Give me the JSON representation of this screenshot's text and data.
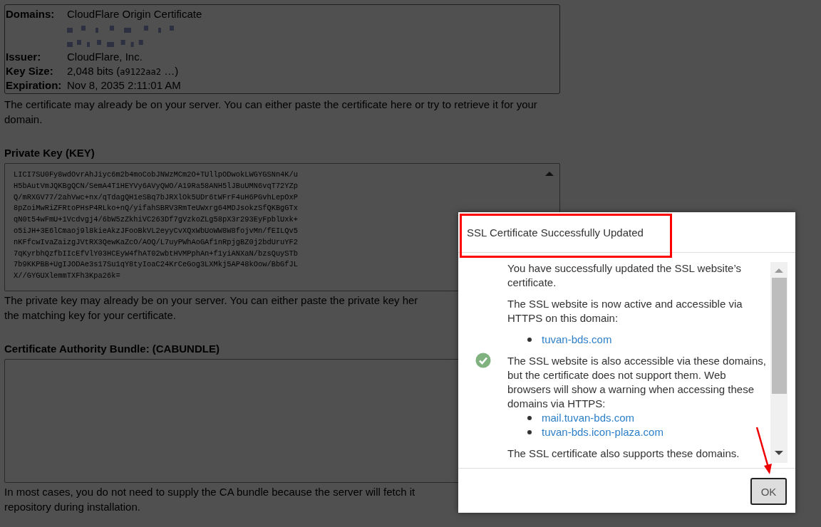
{
  "certificate": {
    "rows": [
      {
        "kind": "text",
        "label": "Domains:",
        "value": "CloudFlare Origin Certificate"
      },
      {
        "kind": "redacted"
      },
      {
        "kind": "redacted"
      },
      {
        "kind": "text",
        "label": "Issuer:",
        "value": "CloudFlare, Inc."
      },
      {
        "kind": "keysize",
        "label": "Key Size:",
        "value": "2,048 bits (",
        "code": "a9122aa2",
        "suffix": " …)"
      },
      {
        "kind": "text",
        "label": "Expiration:",
        "value": "Nov 8, 2035 2:11:01 AM"
      }
    ],
    "help": "The certificate may already be on your server. You can either paste the certificate here or try to retrieve it for your domain."
  },
  "private_key": {
    "label": "Private Key (KEY)",
    "lines": [
      "LICI7SU0Fy8wdOvrAhJiyc6m2b4moCobJNWzMCm2O+TUllpODwokLWGYGSNn4K/u",
      "H5bAutVmJQKBgQCN/SemA4T1HEYVy6AVyQWO/A19Ra58ANH5lJBuUMN6vqT72YZp",
      "Q/mRXGV77/2ahVwc+nx/qTdagQH1eSBq7bJRXlOk5UDr6tWFrF4uH6PGvhLepOxP",
      "8pZoiMwRiZFRtoPHsP4RLko+nQ/yifahSBRV3RmTeUWxrg64MDJsokzSfQKBgGTx",
      "qN0t54wFmU+1Vcdvgj4/6bW5zZkhiVC263Df7gVzkoZLg58pX3r293EyFpblUxk+",
      "o5iJH+3E6lCmaoj9l8kieAkzJFooBkVL2eyyCvXQxWbUoWW8W8fojvMn/fEILQv5",
      "nKFfcwIvaZaizgJVtRX3QewKaZcO/AOQ/L7uyPWhAoGAf1nRpjgBZ0j2bdUruYF2",
      "7qKyrbhQzfbIIcEfVlY03HCEyW4fhAT02wbtHVMPphAn+f1yiANXaN/bzsQuySTb",
      "7b9KKPBB+UgIJODAe3s17Su1qY8tyIoaC24KrCeGog3LXMkj5AP48kOow/BbGfJL",
      "X//GYGUXlemmTXFh3Kpa26k="
    ],
    "help_lines": [
      "The private key may already be on your server. You can either paste the private key her",
      "the matching key for your certificate."
    ]
  },
  "ca_bundle": {
    "label": "Certificate Authority Bundle: (CABUNDLE)",
    "help_lines": [
      "In most cases, you do not need to supply the CA bundle because the server will fetch it",
      "repository during installation."
    ]
  },
  "dialog": {
    "title": "SSL Certificate Successfully Updated",
    "body": [
      {
        "kind": "text",
        "text": "You have successfully updated the SSL website’s certificate."
      },
      {
        "kind": "text",
        "text": "The SSL website is now active and accessible via HTTPS on this domain:"
      },
      {
        "kind": "list",
        "items": [
          "tuvan-bds.com"
        ]
      },
      {
        "kind": "text",
        "text": "The SSL website is also accessible via these domains, but the certificate does not support them. Web browsers will show a warning when accessing these domains via HTTPS:"
      },
      {
        "kind": "list",
        "items": [
          "mail.tuvan-bds.com",
          "tuvan-bds.icon-plaza.com"
        ]
      },
      {
        "kind": "text",
        "text": "The SSL certificate also supports these domains."
      }
    ],
    "ok_button": "OK"
  }
}
